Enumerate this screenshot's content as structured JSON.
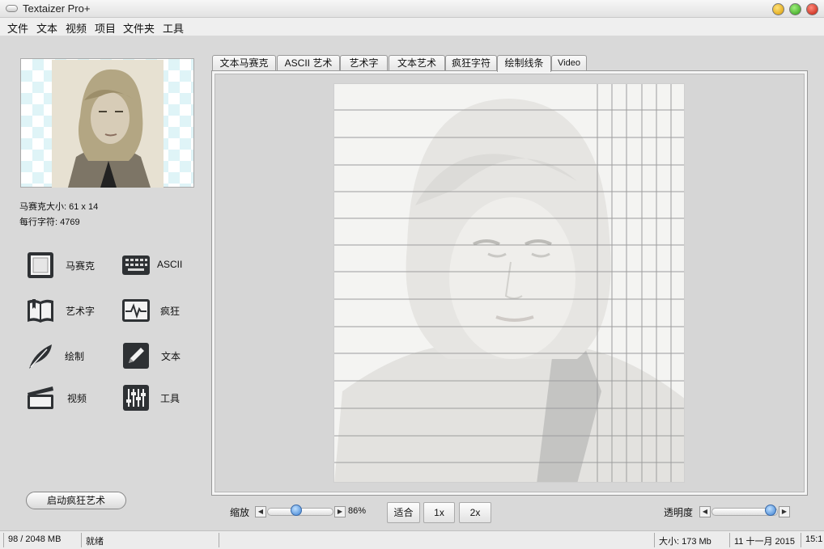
{
  "window": {
    "title": "Textaizer Pro+"
  },
  "menu": [
    "文件",
    "文本",
    "视频",
    "项目",
    "文件夹",
    "工具"
  ],
  "info": {
    "mosaic_size": "马赛克大小: 61 x 14",
    "chars_per_line": "每行字符: 4769"
  },
  "tools": [
    {
      "label": "马赛克",
      "icon": "mosaic-icon"
    },
    {
      "label": "ASCII",
      "icon": "keyboard-icon"
    },
    {
      "label": "艺术字",
      "icon": "book-icon"
    },
    {
      "label": "疯狂",
      "icon": "pulse-icon"
    },
    {
      "label": "绘制",
      "icon": "feather-icon"
    },
    {
      "label": "文本",
      "icon": "pencil-icon"
    },
    {
      "label": "视频",
      "icon": "clapperboard-icon"
    },
    {
      "label": "工具",
      "icon": "equalizer-icon"
    }
  ],
  "launch_button": "启动疯狂艺术",
  "tabs": [
    {
      "label": "文本马赛克",
      "active": false
    },
    {
      "label": "ASCII 艺术",
      "active": false
    },
    {
      "label": "艺术字",
      "active": false
    },
    {
      "label": "文本艺术",
      "active": false
    },
    {
      "label": "疯狂字符",
      "active": false
    },
    {
      "label": "绘制线条",
      "active": true
    },
    {
      "label": "Video",
      "active": false
    }
  ],
  "zoom": {
    "label": "缩放",
    "value_text": "86%",
    "level": 0.86
  },
  "zoom_buttons": {
    "fit": "适合",
    "one_x": "1x",
    "two_x": "2x"
  },
  "opacity": {
    "label": "透明度",
    "level": 0.95
  },
  "status": {
    "memory": "98 / 2048 MB",
    "state": "就绪",
    "size": "大小: 173 Mb",
    "date": "11 十一月 2015",
    "time": "15:1"
  },
  "colors": {
    "accent_knob": "#3b7fd1",
    "background": "#d9d9d9"
  }
}
